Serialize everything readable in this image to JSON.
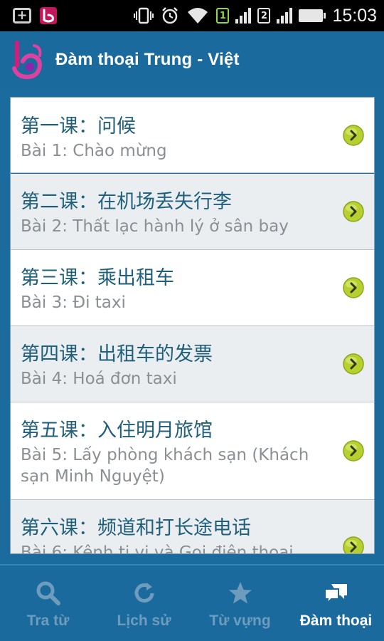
{
  "status_bar": {
    "time": "15:03",
    "sim1": "1",
    "sim2": "2"
  },
  "action_bar": {
    "title": "Đàm thoại Trung - Việt",
    "logo_icon": "app-logo-icon"
  },
  "lessons": [
    {
      "zh": "第一课：问候",
      "vi": "Bài 1: Chào mừng"
    },
    {
      "zh": "第二课：在机场丢失行李",
      "vi": "Bài 2: Thất lạc hành lý ở sân bay"
    },
    {
      "zh": "第三课：乘出租车",
      "vi": "Bài 3: Đi taxi"
    },
    {
      "zh": "第四课：出租车的发票",
      "vi": "Bài 4: Hoá đơn taxi"
    },
    {
      "zh": "第五课：入住明月旅馆",
      "vi": "Bài 5: Lấy phòng khách sạn (Khách sạn Minh Nguyệt)"
    },
    {
      "zh": "第六课：频道和打长途电话",
      "vi": "Bài 6: Kênh ti vi và Gọi điện thoại"
    }
  ],
  "tabs": [
    {
      "label": "Tra từ",
      "icon": "search-icon",
      "active": false
    },
    {
      "label": "Lịch sử",
      "icon": "history-icon",
      "active": false
    },
    {
      "label": "Từ vựng",
      "icon": "star-icon",
      "active": false
    },
    {
      "label": "Đàm thoại",
      "icon": "chat-icon",
      "active": true
    }
  ],
  "colors": {
    "action_bar": "#1b6a9e",
    "chinese_text": "#1f5f7c",
    "viet_text": "#8a8f93",
    "arrow_green": "#b7d030",
    "tab_inactive": "#6d9cbd",
    "tab_active": "#ffffff"
  }
}
